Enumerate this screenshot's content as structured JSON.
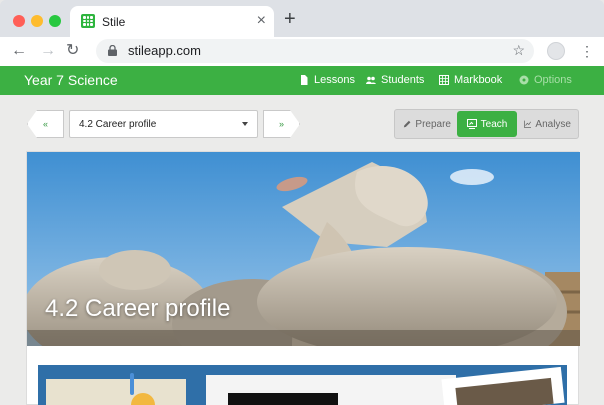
{
  "browser": {
    "tab_title": "Stile",
    "tab_close": "×",
    "new_tab": "+",
    "url": "stileapp.com",
    "icons": [
      "back-arrow-icon",
      "forward-arrow-icon",
      "reload-icon",
      "lock-icon",
      "star-icon",
      "profile-icon",
      "kebab-menu-icon"
    ]
  },
  "app": {
    "course_title": "Year 7 Science",
    "nav": [
      {
        "label": "Lessons",
        "icon": "lessons-icon"
      },
      {
        "label": "Students",
        "icon": "students-icon"
      },
      {
        "label": "Markbook",
        "icon": "markbook-icon"
      },
      {
        "label": "Options",
        "icon": "options-icon",
        "disabled": true
      }
    ],
    "brand_color": "#3cb043"
  },
  "lesson_bar": {
    "prev": "«",
    "next": "»",
    "selected_lesson": "4.2 Career profile",
    "modes": [
      {
        "label": "Prepare",
        "active": false
      },
      {
        "label": "Teach",
        "active": true
      },
      {
        "label": "Analyse",
        "active": false
      }
    ]
  },
  "lesson_card": {
    "title": "4.2 Career profile"
  }
}
